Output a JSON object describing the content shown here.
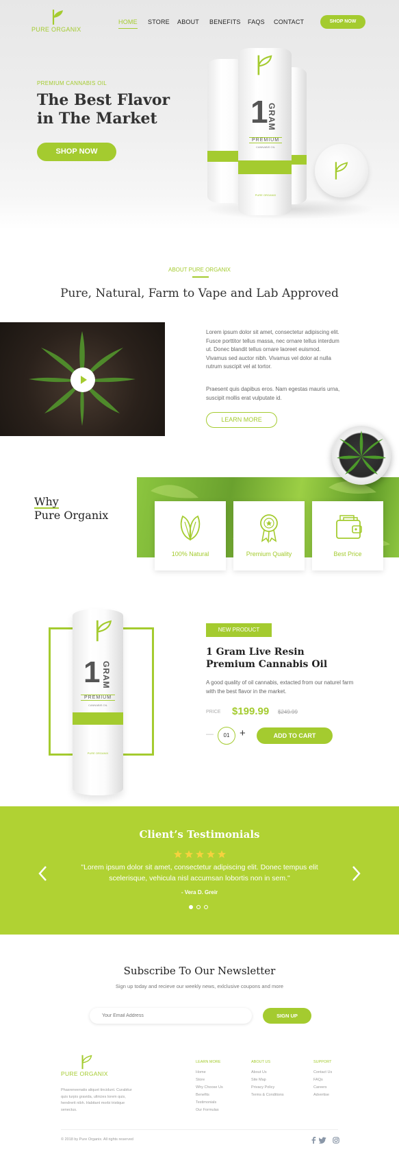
{
  "brand": {
    "name": "PURE ORGANIX",
    "accent": "#a4cb2f"
  },
  "nav": {
    "items": [
      "HOME",
      "STORE",
      "ABOUT",
      "BENEFITS",
      "FAQS",
      "CONTACT"
    ],
    "cta": "SHOP NOW"
  },
  "hero": {
    "eyebrow": "PREMIUM CANNABIS OIL",
    "title_line1": "The Best Flavor",
    "title_line2": "in The Market",
    "cta": "SHOP NOW",
    "product": {
      "big_number": "1",
      "unit": "GRAM",
      "label": "PREMIUM",
      "sub": "CANNABIS OIL",
      "brand": "PURE ORGANIX"
    }
  },
  "about": {
    "eyebrow": "ABOUT PURE ORGANIX",
    "heading": "Pure, Natural, Farm to Vape and Lab Approved",
    "para1": "Lorem ipsum dolor sit amet, consectetur adipiscing elit. Fusce porttitor tellus massa, nec ornare tellus interdum ut. Donec blandit tellus ornare laoreet euismod. Vivamus sed auctor nibh. Vivamus vel dolor at nulla rutrum suscipit vel at tortor.",
    "para2": "Praesent quis dapibus eros. Nam egestas mauris urna, suscipit mollis erat vulputate id.",
    "cta": "LEARN MORE"
  },
  "why": {
    "line1": "Why",
    "line2": "Pure Organix",
    "cards": [
      {
        "icon": "leaf-icon",
        "label": "100% Natural"
      },
      {
        "icon": "award-badge-icon",
        "label": "Premium Quality"
      },
      {
        "icon": "wallet-icon",
        "label": "Best Price"
      }
    ]
  },
  "product": {
    "badge": "NEW PRODUCT",
    "name_line1": "1 Gram Live Resin",
    "name_line2": "Premium Cannabis Oil",
    "description": "A good quality of oil cannabis, extacted from our naturel farm with the best flavor in the market.",
    "price_label": "PRICE",
    "price": "$199.99",
    "old_price": "$249.99",
    "quantity": "01",
    "minus": "—",
    "plus": "+",
    "cta": "ADD TO CART"
  },
  "testimonials": {
    "heading": "Client’s Testimonials",
    "rating": 5,
    "quote_line1": "\"Lorem ipsum dolor sit amet, consectetur adipiscing elit. Donec tempus elit",
    "quote_line2": "scelerisque, vehicula nisl  accumsan lobortis non in sem.\"",
    "author": "- Vera D. Greir",
    "slides": 3,
    "active_slide": 1
  },
  "newsletter": {
    "heading": "Subscribe To Our Newsletter",
    "subtext": "Sign up today and recieve our weekly news, exlclusive coupons and more",
    "placeholder": "Your Email Address",
    "cta": "SIGN UP"
  },
  "footer": {
    "about": "Phasreneenatis aliquet tincidunt. Curabitur quis turpis gravida, ultricies lorem quis, hendrerit nibh. Habitant morbi tristique senectus.",
    "columns": [
      {
        "title": "LEARN MORE",
        "links": [
          "Home",
          "Store",
          "Why Choose Us",
          "Benefits",
          "Testimonials",
          "Our Formulas"
        ]
      },
      {
        "title": "ABOUT US",
        "links": [
          "About Us",
          "Site Map",
          "Privacy Policy",
          "Terms & Conditions"
        ]
      },
      {
        "title": "SUPPORT",
        "links": [
          "Contact Us",
          "FAQs",
          "Careers",
          "Advertise"
        ]
      }
    ],
    "copyright": "© 2018 by Pure Organix. All rights reserved",
    "social": [
      "facebook-icon",
      "twitter-icon",
      "instagram-icon"
    ]
  }
}
